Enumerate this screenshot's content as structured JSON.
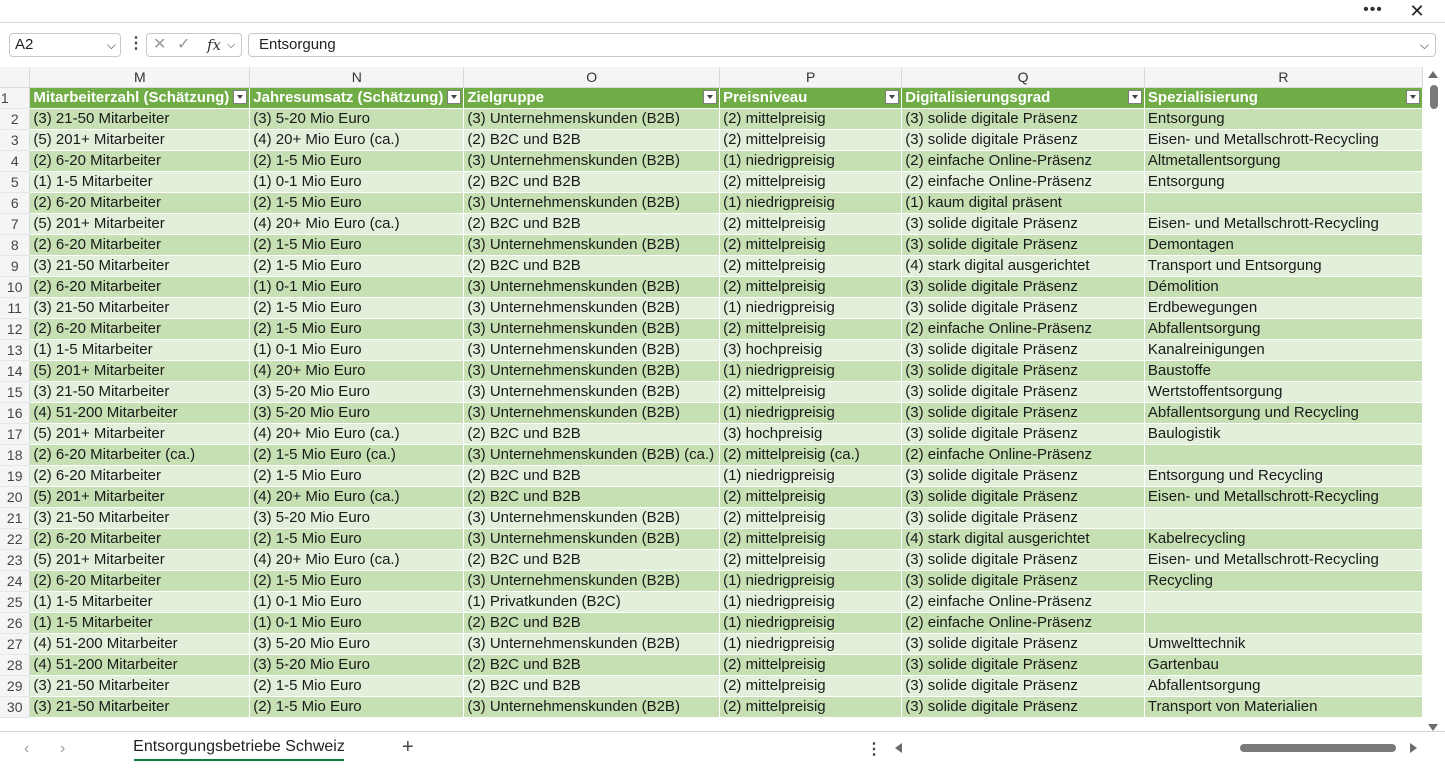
{
  "window": {
    "more_icon": "ellipsis-icon",
    "close_icon": "close-icon"
  },
  "formula_bar": {
    "name_box": "A2",
    "content": "Entsorgung"
  },
  "columns": [
    "M",
    "N",
    "O",
    "P",
    "Q",
    "R"
  ],
  "headers": [
    "Mitarbeiterzahl (Schätzung)",
    "Jahresumsatz (Schätzung)",
    "Zielgruppe",
    "Preisniveau",
    "Digitalisierungsgrad",
    "Spezialisierung"
  ],
  "rows": [
    [
      "(3) 21-50 Mitarbeiter",
      "(3) 5-20 Mio Euro",
      "(3) Unternehmenskunden (B2B)",
      "(2) mittelpreisig",
      "(3) solide digitale Präsenz",
      "Entsorgung"
    ],
    [
      "(5) 201+ Mitarbeiter",
      "(4) 20+ Mio Euro (ca.)",
      "(2) B2C und B2B",
      "(2) mittelpreisig",
      "(3) solide digitale Präsenz",
      "Eisen- und Metallschrott-Recycling"
    ],
    [
      "(2) 6-20 Mitarbeiter",
      "(2) 1-5 Mio Euro",
      "(3) Unternehmenskunden (B2B)",
      "(1) niedrigpreisig",
      "(2) einfache Online-Präsenz",
      "Altmetallentsorgung"
    ],
    [
      "(1) 1-5 Mitarbeiter",
      "(1) 0-1 Mio Euro",
      "(2) B2C und B2B",
      "(2) mittelpreisig",
      "(2) einfache Online-Präsenz",
      "Entsorgung"
    ],
    [
      "(2) 6-20 Mitarbeiter",
      "(2) 1-5 Mio Euro",
      "(3) Unternehmenskunden (B2B)",
      "(1) niedrigpreisig",
      "(1) kaum digital präsent",
      ""
    ],
    [
      "(5) 201+ Mitarbeiter",
      "(4) 20+ Mio Euro (ca.)",
      "(2) B2C und B2B",
      "(2) mittelpreisig",
      "(3) solide digitale Präsenz",
      "Eisen- und Metallschrott-Recycling"
    ],
    [
      "(2) 6-20 Mitarbeiter",
      "(2) 1-5 Mio Euro",
      "(3) Unternehmenskunden (B2B)",
      "(2) mittelpreisig",
      "(3) solide digitale Präsenz",
      "Demontagen"
    ],
    [
      "(3) 21-50 Mitarbeiter",
      "(2) 1-5 Mio Euro",
      "(2) B2C und B2B",
      "(2) mittelpreisig",
      "(4) stark digital ausgerichtet",
      "Transport und Entsorgung"
    ],
    [
      "(2) 6-20 Mitarbeiter",
      "(1) 0-1 Mio Euro",
      "(3) Unternehmenskunden (B2B)",
      "(2) mittelpreisig",
      "(3) solide digitale Präsenz",
      "Démolition"
    ],
    [
      "(3) 21-50 Mitarbeiter",
      "(2) 1-5 Mio Euro",
      "(3) Unternehmenskunden (B2B)",
      "(1) niedrigpreisig",
      "(3) solide digitale Präsenz",
      "Erdbewegungen"
    ],
    [
      "(2) 6-20 Mitarbeiter",
      "(2) 1-5 Mio Euro",
      "(3) Unternehmenskunden (B2B)",
      "(2) mittelpreisig",
      "(2) einfache Online-Präsenz",
      "Abfallentsorgung"
    ],
    [
      "(1) 1-5 Mitarbeiter",
      "(1) 0-1 Mio Euro",
      "(3) Unternehmenskunden (B2B)",
      "(3) hochpreisig",
      "(3) solide digitale Präsenz",
      "Kanalreinigungen"
    ],
    [
      "(5) 201+ Mitarbeiter",
      "(4) 20+ Mio Euro",
      "(3) Unternehmenskunden (B2B)",
      "(1) niedrigpreisig",
      "(3) solide digitale Präsenz",
      "Baustoffe"
    ],
    [
      "(3) 21-50 Mitarbeiter",
      "(3) 5-20 Mio Euro",
      "(3) Unternehmenskunden (B2B)",
      "(2) mittelpreisig",
      "(3) solide digitale Präsenz",
      "Wertstoffentsorgung"
    ],
    [
      "(4) 51-200 Mitarbeiter",
      "(3) 5-20 Mio Euro",
      "(3) Unternehmenskunden (B2B)",
      "(1) niedrigpreisig",
      "(3) solide digitale Präsenz",
      "Abfallentsorgung und Recycling"
    ],
    [
      "(5) 201+ Mitarbeiter",
      "(4) 20+ Mio Euro (ca.)",
      "(2) B2C und B2B",
      "(3) hochpreisig",
      "(3) solide digitale Präsenz",
      "Baulogistik"
    ],
    [
      "(2) 6-20 Mitarbeiter (ca.)",
      "(2) 1-5 Mio Euro (ca.)",
      "(3) Unternehmenskunden (B2B) (ca.)",
      "(2) mittelpreisig (ca.)",
      "(2) einfache Online-Präsenz",
      ""
    ],
    [
      "(2) 6-20 Mitarbeiter",
      "(2) 1-5 Mio Euro",
      "(2) B2C und B2B",
      "(1) niedrigpreisig",
      "(3) solide digitale Präsenz",
      "Entsorgung und Recycling"
    ],
    [
      "(5) 201+ Mitarbeiter",
      "(4) 20+ Mio Euro (ca.)",
      "(2) B2C und B2B",
      "(2) mittelpreisig",
      "(3) solide digitale Präsenz",
      "Eisen- und Metallschrott-Recycling"
    ],
    [
      "(3) 21-50 Mitarbeiter",
      "(3) 5-20 Mio Euro",
      "(3) Unternehmenskunden (B2B)",
      "(2) mittelpreisig",
      "(3) solide digitale Präsenz",
      ""
    ],
    [
      "(2) 6-20 Mitarbeiter",
      "(2) 1-5 Mio Euro",
      "(3) Unternehmenskunden (B2B)",
      "(2) mittelpreisig",
      "(4) stark digital ausgerichtet",
      "Kabelrecycling"
    ],
    [
      "(5) 201+ Mitarbeiter",
      "(4) 20+ Mio Euro (ca.)",
      "(2) B2C und B2B",
      "(2) mittelpreisig",
      "(3) solide digitale Präsenz",
      "Eisen- und Metallschrott-Recycling"
    ],
    [
      "(2) 6-20 Mitarbeiter",
      "(2) 1-5 Mio Euro",
      "(3) Unternehmenskunden (B2B)",
      "(1) niedrigpreisig",
      "(3) solide digitale Präsenz",
      "Recycling"
    ],
    [
      "(1) 1-5 Mitarbeiter",
      "(1) 0-1 Mio Euro",
      "(1) Privatkunden (B2C)",
      "(1) niedrigpreisig",
      "(2) einfache Online-Präsenz",
      ""
    ],
    [
      "(1) 1-5 Mitarbeiter",
      "(1) 0-1 Mio Euro",
      "(2) B2C und B2B",
      "(1) niedrigpreisig",
      "(2) einfache Online-Präsenz",
      ""
    ],
    [
      "(4) 51-200 Mitarbeiter",
      "(3) 5-20 Mio Euro",
      "(3) Unternehmenskunden (B2B)",
      "(1) niedrigpreisig",
      "(3) solide digitale Präsenz",
      "Umwelttechnik"
    ],
    [
      "(4) 51-200 Mitarbeiter",
      "(3) 5-20 Mio Euro",
      "(2) B2C und B2B",
      "(2) mittelpreisig",
      "(3) solide digitale Präsenz",
      "Gartenbau"
    ],
    [
      "(3) 21-50 Mitarbeiter",
      "(2) 1-5 Mio Euro",
      "(2) B2C und B2B",
      "(2) mittelpreisig",
      "(3) solide digitale Präsenz",
      "Abfallentsorgung"
    ],
    [
      "(3) 21-50 Mitarbeiter",
      "(2) 1-5 Mio Euro",
      "(3) Unternehmenskunden (B2B)",
      "(2) mittelpreisig",
      "(3) solide digitale Präsenz",
      "Transport von Materialien"
    ]
  ],
  "sheet_tabs": {
    "active": "Entsorgungsbetriebe Schweiz",
    "add_label": "+"
  },
  "colors": {
    "header_green": "#70ad47",
    "band_dark": "#c6e0b4",
    "band_light": "#e2efda",
    "tab_underline": "#107c41"
  }
}
